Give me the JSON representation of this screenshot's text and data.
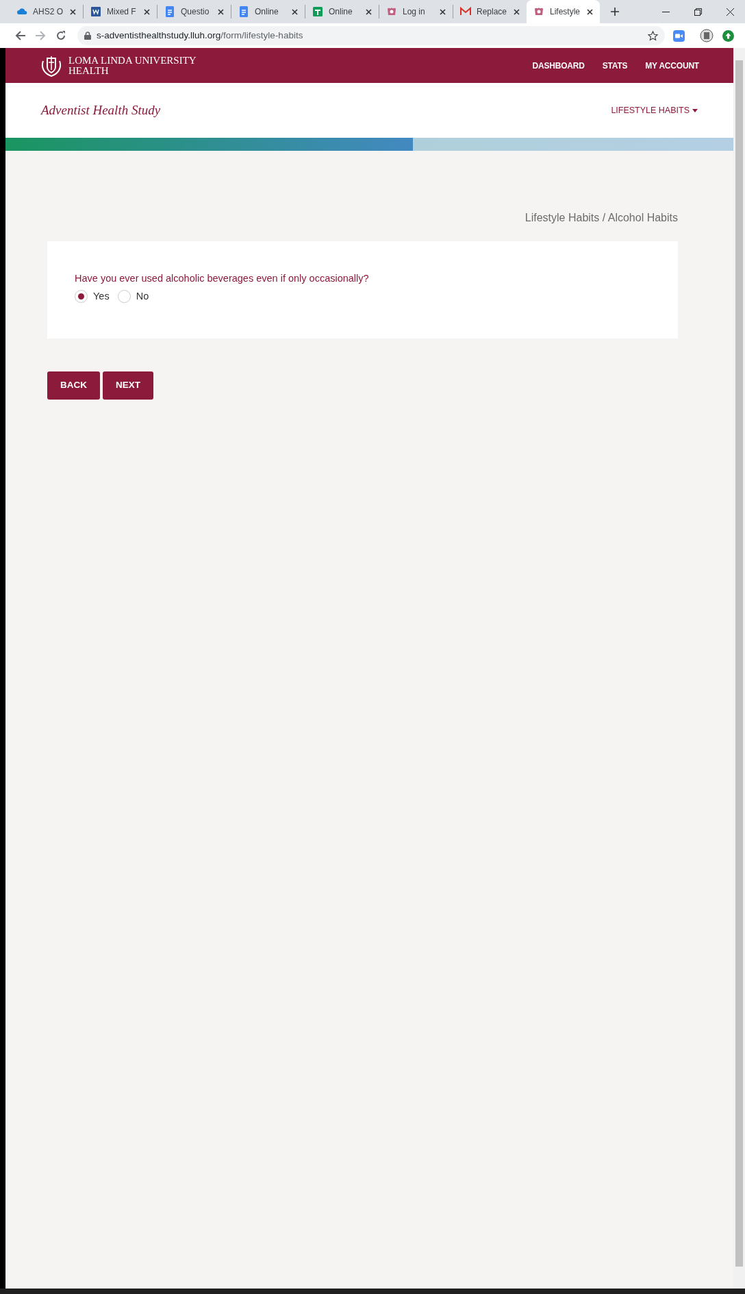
{
  "browser": {
    "tabs": [
      {
        "title": "AHS2 O",
        "kind": "cloud",
        "selected": false
      },
      {
        "title": "Mixed F",
        "kind": "word",
        "selected": false
      },
      {
        "title": "Questio",
        "kind": "docs",
        "selected": false
      },
      {
        "title": "Online",
        "kind": "docs",
        "selected": false
      },
      {
        "title": "Online",
        "kind": "sheets",
        "selected": false
      },
      {
        "title": "Log in",
        "kind": "crest",
        "selected": false
      },
      {
        "title": "Replace",
        "kind": "gmail",
        "selected": false
      },
      {
        "title": "Lifestyle",
        "kind": "crest",
        "selected": true
      }
    ],
    "url": {
      "host": "s-adventisthealthstudy.lluh.org",
      "path": "/form/lifestyle-habits"
    }
  },
  "header": {
    "brand": [
      "LOMA LINDA UNIVERSITY",
      "HEALTH"
    ],
    "nav": [
      "DASHBOARD",
      "STATS",
      "MY ACCOUNT"
    ]
  },
  "subheader": {
    "title": "Adventist Health Study",
    "menu": "LIFESTYLE HABITS"
  },
  "progress": {
    "level": 0.56
  },
  "breadcrumb": "Lifestyle Habits / Alcohol Habits",
  "question": {
    "text": "Have you ever used alcoholic beverages even if only occasionally?",
    "options": [
      {
        "label": "Yes",
        "selected": true
      },
      {
        "label": "No",
        "selected": false
      }
    ]
  },
  "buttons": [
    "BACK",
    "NEXT"
  ]
}
